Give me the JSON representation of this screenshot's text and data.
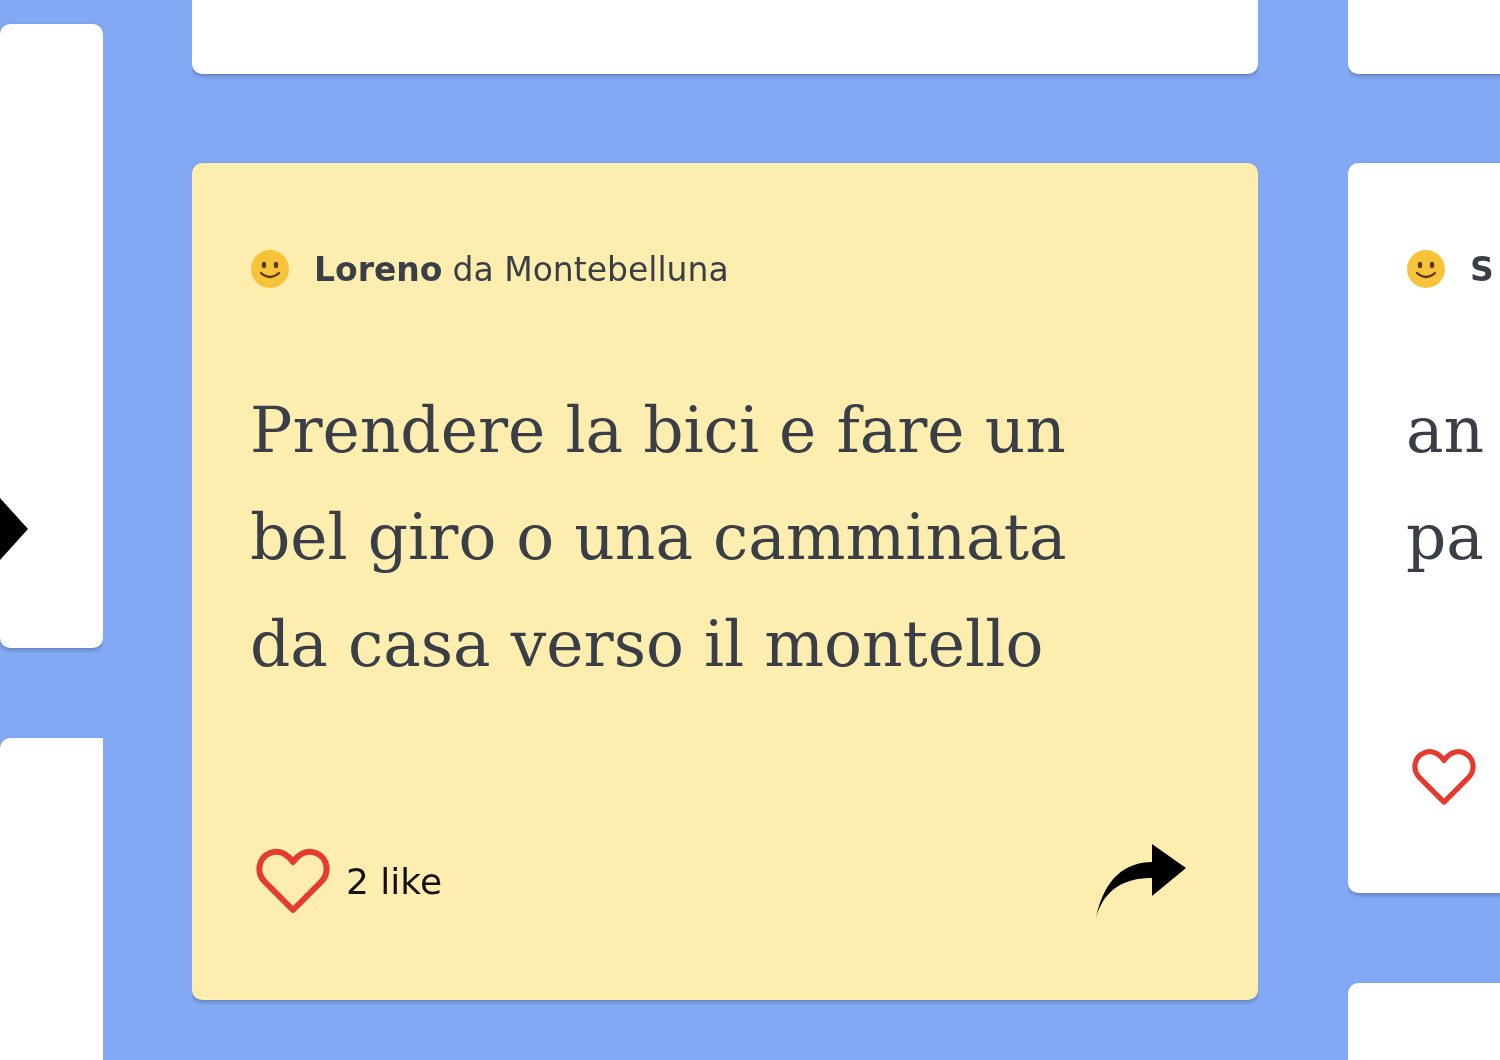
{
  "columns": [
    {
      "cards": [
        {
          "kind": "share_only",
          "color": "#ffffff"
        },
        {
          "kind": "blank",
          "color": "#ffffff"
        }
      ]
    },
    {
      "cards": [
        {
          "kind": "blank",
          "color": "#ffffff"
        },
        {
          "kind": "post",
          "color": "#fdeeb0",
          "author": "Loreno",
          "place": "da Montebelluna",
          "lines": [
            "Prendere la bici e fare un",
            "bel giro o una camminata",
            "da casa verso il montello"
          ],
          "likes": "2 like",
          "liked": false
        }
      ]
    },
    {
      "cards": [
        {
          "kind": "blank",
          "color": "#ffffff"
        },
        {
          "kind": "post",
          "color": "#ffffff",
          "author": "S",
          "lines": [
            "an",
            "pa"
          ],
          "liked": false
        },
        {
          "kind": "blank",
          "color": "#ffffff"
        }
      ]
    }
  ]
}
